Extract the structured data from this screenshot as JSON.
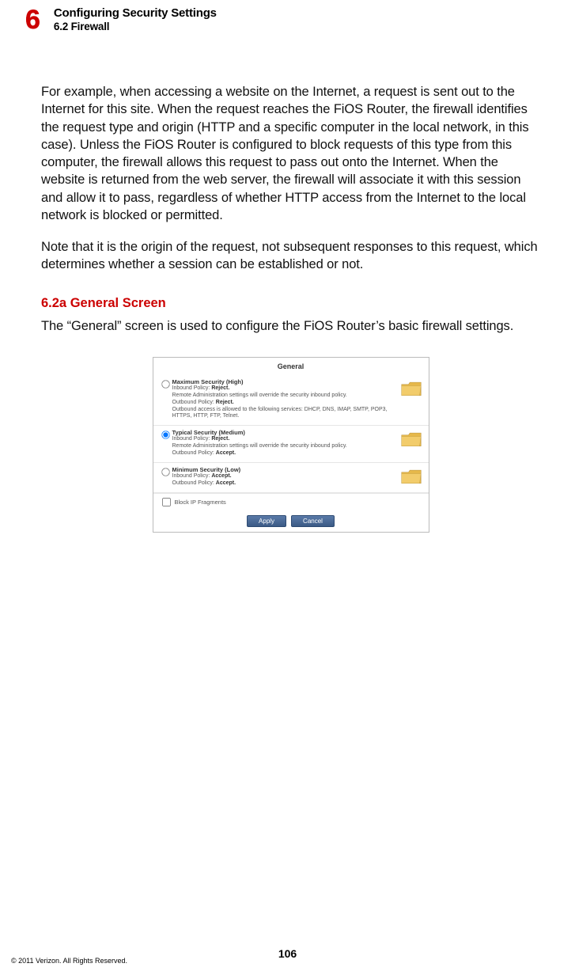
{
  "header": {
    "chapter_number": "6",
    "chapter_title": "Configuring Security Settings",
    "section_label": "6.2  Firewall"
  },
  "body": {
    "para1": "For example, when accessing a website on the Internet, a request is sent out to the Internet for this site. When the request reaches the FiOS Router, the firewall identifies the request type and origin (HTTP and a specific computer in the local network, in this case). Unless the FiOS Router is configured to block requests of this type from this computer, the firewall allows this request to pass out onto the Internet. When the website is returned from the web server, the firewall will associate it with this session and allow it to pass, regardless of whether HTTP access from the Internet to the local network is blocked or permitted.",
    "para2": "Note that it is the origin of the request, not subsequent responses to this request, which determines whether a session can be established or not.",
    "subsection_title": "6.2a  General Screen",
    "para3": "The “General” screen is used to configure the FiOS Router’s basic firewall settings."
  },
  "panel": {
    "title": "General",
    "options": [
      {
        "title": "Maximum Security (High)",
        "line1_label": "Inbound Policy:",
        "line1_value": "Reject.",
        "line2": "Remote Administration settings will override the security inbound policy.",
        "line3_label": "Outbound Policy:",
        "line3_value": "Reject.",
        "line4": "Outbound access is allowed to the following services: DHCP, DNS, IMAP, SMTP, POP3, HTTPS, HTTP, FTP, Telnet.",
        "selected": false
      },
      {
        "title": "Typical Security (Medium)",
        "line1_label": "Inbound Policy:",
        "line1_value": "Reject.",
        "line2": "Remote Administration settings will override the security inbound policy.",
        "line3_label": "Outbound Policy:",
        "line3_value": "Accept.",
        "line4": "",
        "selected": true
      },
      {
        "title": "Minimum Security (Low)",
        "line1_label": "Inbound Policy:",
        "line1_value": "Accept.",
        "line2": "",
        "line3_label": "Outbound Policy:",
        "line3_value": "Accept.",
        "line4": "",
        "selected": false
      }
    ],
    "block_ip_label": "Block IP Fragments",
    "apply_label": "Apply",
    "cancel_label": "Cancel"
  },
  "footer": {
    "page_number": "106",
    "copyright": "© 2011 Verizon. All Rights Reserved."
  }
}
